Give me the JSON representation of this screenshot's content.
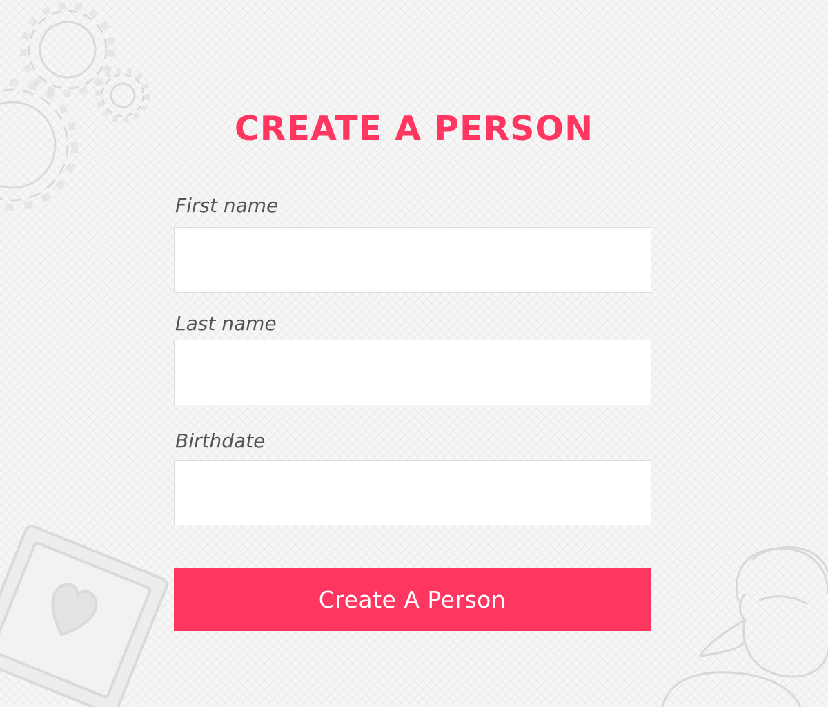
{
  "page": {
    "title": "CREATE A PERSON"
  },
  "form": {
    "fields": [
      {
        "label": "First name",
        "value": "",
        "placeholder": ""
      },
      {
        "label": "Last name",
        "value": "",
        "placeholder": ""
      },
      {
        "label": "Birthdate",
        "value": "",
        "placeholder": ""
      }
    ],
    "submit_label": "Create A Person"
  },
  "colors": {
    "accent": "#ff3660",
    "label": "#545454",
    "background": "#f6f6f6"
  },
  "icons": [
    "gear-icon",
    "picture-frame-heart-icon",
    "person-silhouette-icon"
  ]
}
